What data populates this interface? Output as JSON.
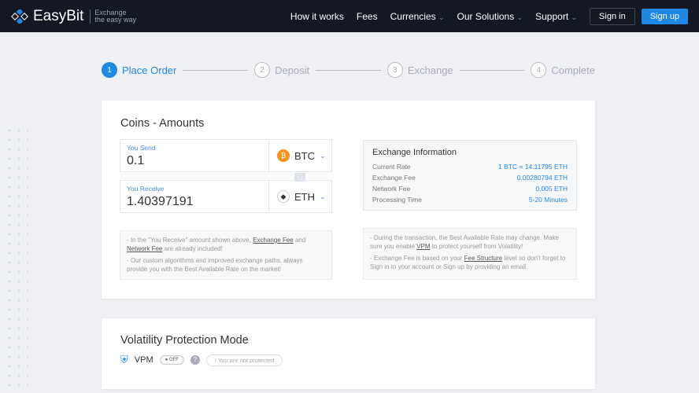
{
  "nav": {
    "brand": "EasyBit",
    "tagline1": "Exchange",
    "tagline2": "the easy way",
    "links": [
      "How it works",
      "Fees",
      "Currencies",
      "Our Solutions",
      "Support"
    ],
    "signin": "Sign in",
    "signup": "Sign up"
  },
  "steps": [
    {
      "n": "1",
      "label": "Place Order"
    },
    {
      "n": "2",
      "label": "Deposit"
    },
    {
      "n": "3",
      "label": "Exchange"
    },
    {
      "n": "4",
      "label": "Complete"
    }
  ],
  "coins": {
    "title": "Coins - Amounts",
    "send_label": "You Send",
    "send_value": "0.1",
    "send_cur": "BTC",
    "recv_label": "You Receive",
    "recv_value": "1.40397191",
    "recv_cur": "ETH",
    "swap": "↑↓"
  },
  "info": {
    "title": "Exchange Information",
    "rows": [
      {
        "k": "Current Rate",
        "v": "1 BTC = 14.11795 ETH"
      },
      {
        "k": "Exchange Fee",
        "v": "0.00280794 ETH"
      },
      {
        "k": "Network Fee",
        "v": "0.005 ETH"
      },
      {
        "k": "Processing Time",
        "v": "5-20 Minutes"
      }
    ]
  },
  "notes_left": {
    "a1": "- In the \"You Receive\" amount shown above, ",
    "a2": "Exchange Fee",
    "a3": " and ",
    "a4": "Network Fee",
    "a5": " are already included!",
    "b": "- Our custom algorithms and improved exchange paths, always provide you with the Best Available Rate on the market!"
  },
  "notes_right": {
    "a1": "- During the transaction, the Best Available Rate may change. Make sure you enable ",
    "a2": "VPM",
    "a3": " to protect yourself from Volatility!",
    "b1": "- Exchange Fee is based on your ",
    "b2": "Fee Structure",
    "b3": " level so don't forget to Sign in to your account or Sign up by providing an email."
  },
  "vpm": {
    "title": "Volatility Protection Mode",
    "label": "VPM",
    "toggle": "OFF",
    "help": "?",
    "status": "!  You are not protected"
  }
}
